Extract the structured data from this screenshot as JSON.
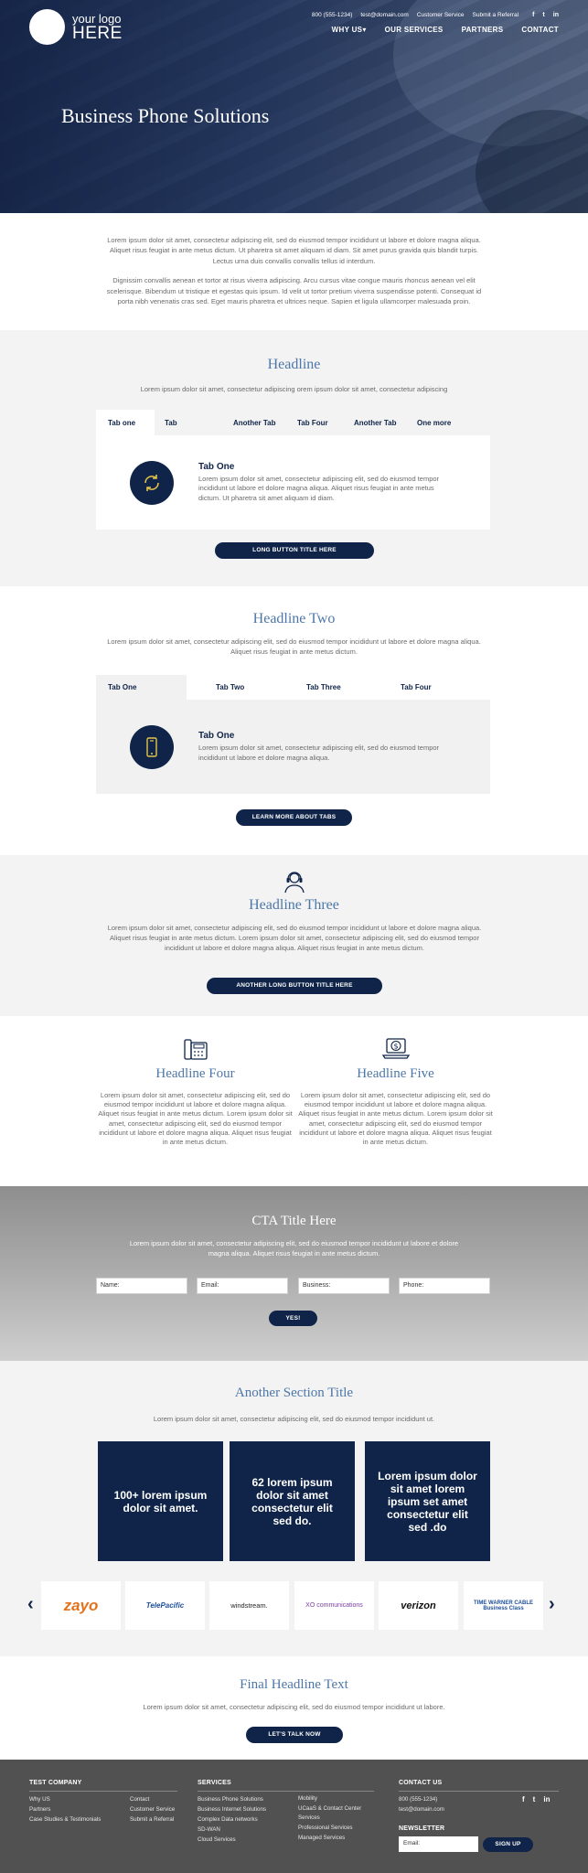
{
  "header": {
    "logo_line1": "your logo",
    "logo_line2": "HERE",
    "phone": "800 (555-1234)",
    "email": "test@domain.com",
    "customer_service": "Customer Service",
    "submit_referral": "Submit a Referral",
    "social": [
      "f",
      "t",
      "in"
    ],
    "nav": [
      "WHY US",
      "OUR SERVICES",
      "PARTNERS",
      "CONTACT"
    ],
    "nav_dropdown_caret": "▾"
  },
  "hero": {
    "title": "Business Phone Solutions"
  },
  "intro": {
    "p1": "Lorem ipsum dolor sit amet, consectetur adipiscing elit, sed do eiusmod tempor incididunt ut labore et dolore magna aliqua. Aliquet risus feugiat in ante metus dictum. Ut pharetra sit amet aliquam id diam. Sit amet purus gravida quis blandit turpis. Lectus urna duis convallis convallis tellus id interdum.",
    "p2": "Dignissim convallis aenean et tortor at risus viverra adipiscing. Arcu cursus vitae congue mauris rhoncus aenean vel elit scelerisque. Bibendum ut tristique et egestas quis ipsum. Id velit ut tortor pretium viverra suspendisse potenti. Consequat id porta nibh venenatis cras sed. Eget mauris pharetra et ultrices neque. Sapien et ligula ullamcorper malesuada proin."
  },
  "section1": {
    "headline": "Headline",
    "sub": "Lorem ipsum dolor sit amet, consectetur adipiscing orem ipsum dolor sit amet, consectetur adipiscing",
    "tabs": [
      "Tab one",
      "Tab",
      "Another Tab",
      "Tab Four",
      "Another Tab",
      "One more"
    ],
    "panel_title": "Tab One",
    "panel_text": "Lorem ipsum dolor sit amet, consectetur adipiscing elit, sed do eiusmod tempor incididunt ut labore et dolore magna aliqua. Aliquet risus feugiat in ante metus dictum. Ut pharetra sit amet aliquam id diam.",
    "panel_icon": "refresh-icon",
    "button": "LONG BUTTON TITLE HERE"
  },
  "section2": {
    "headline": "Headline Two",
    "sub": "Lorem ipsum dolor sit amet, consectetur adipiscing elit, sed do eiusmod tempor incididunt ut labore et dolore magna aliqua. Aliquet risus feugiat in ante metus dictum.",
    "tabs": [
      "Tab One",
      "Tab Two",
      "Tab Three",
      "Tab Four"
    ],
    "panel_title": "Tab One",
    "panel_text": "Lorem ipsum dolor sit amet, consectetur adipiscing elit, sed do eiusmod tempor incididunt ut labore et dolore magna aliqua.",
    "panel_icon": "mobile-phone-icon",
    "button": "LEARN MORE ABOUT TABS"
  },
  "section3": {
    "icon": "headset-agent-icon",
    "headline": "Headline Three",
    "text": "Lorem ipsum dolor sit amet, consectetur adipiscing elit, sed do eiusmod tempor incididunt ut labore et dolore magna aliqua. Aliquet risus feugiat in ante metus dictum. Lorem ipsum dolor sit amet, consectetur adipiscing elit, sed do eiusmod tempor incididunt ut labore et dolore magna aliqua. Aliquet risus feugiat in ante metus dictum.",
    "button": "ANOTHER LONG BUTTON TITLE HERE"
  },
  "section4": {
    "col1": {
      "icon": "fax-phone-icon",
      "headline": "Headline Four",
      "text": "Lorem ipsum dolor sit amet, consectetur adipiscing elit, sed do eiusmod tempor incididunt ut labore et dolore magna aliqua. Aliquet risus feugiat in ante metus dictum. Lorem ipsum dolor sit amet, consectetur adipiscing elit, sed do eiusmod tempor incididunt ut labore et dolore magna aliqua. Aliquet risus feugiat in ante metus dictum."
    },
    "col2": {
      "icon": "laptop-dollar-icon",
      "headline": "Headline Five",
      "text": "Lorem ipsum dolor sit amet, consectetur adipiscing elit, sed do eiusmod tempor incididunt ut labore et dolore magna aliqua. Aliquet risus feugiat in ante metus dictum. Lorem ipsum dolor sit amet, consectetur adipiscing elit, sed do eiusmod tempor incididunt ut labore et dolore magna aliqua. Aliquet risus feugiat in ante metus dictum."
    }
  },
  "cta": {
    "title": "CTA Title Here",
    "text": "Lorem ipsum dolor sit amet, consectetur adipiscing elit, sed do eiusmod tempor incididunt ut labore et dolore magna aliqua. Aliquet risus feugiat in ante metus dictum.",
    "fields": [
      "Name:",
      "Email:",
      "Business:",
      "Phone:"
    ],
    "button": "YES!"
  },
  "section5": {
    "headline": "Another Section Title",
    "sub": "Lorem ipsum dolor sit amet, consectetur adipiscing elit, sed do eiusmod tempor incididunt ut.",
    "stats": [
      "100+ lorem ipsum dolor sit amet.",
      "62 lorem ipsum dolor sit amet consectetur elit sed do.",
      "Lorem ipsum dolor sit amet lorem ipsum set amet consectetur elit sed .do"
    ],
    "partners": [
      "zayo",
      "TelePacific",
      "windstream.",
      "XO communications",
      "verizon",
      "TIME WARNER CABLE Business Class"
    ],
    "prev": "‹",
    "next": "›"
  },
  "final": {
    "headline": "Final Headline Text",
    "text": "Lorem ipsum dolor sit amet, consectetur adipiscing elit, sed do eiusmod tempor incididunt ut labore.",
    "button": "LET'S TALK NOW"
  },
  "footer": {
    "company_title": "TEST COMPANY",
    "company_col1": [
      "Why US",
      "Partners",
      "Case Studies & Testimonials"
    ],
    "company_col2": [
      "Contact",
      "Customer Service",
      "Submit a Referral"
    ],
    "services_title": "SERVICES",
    "services_col1": [
      "Business Phone Solutions",
      "Business Internet Solutions",
      "Complex Data networks",
      "SD-WAN",
      "Cloud Services"
    ],
    "services_col2": [
      "Mobility",
      "UCaaS & Contact Center Services",
      "Professional Services",
      "Managed Services"
    ],
    "contact_title": "CONTACT US",
    "phone": "800 (555-1234)",
    "email": "test@domain.com",
    "newsletter_title": "NEWSLETTER",
    "newsletter_placeholder": "Email:",
    "signup": "SIGN UP",
    "social": [
      "f",
      "t",
      "in"
    ]
  }
}
